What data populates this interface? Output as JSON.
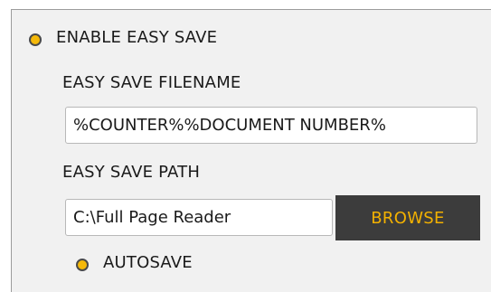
{
  "easy_save": {
    "enable_label": "ENABLE EASY SAVE",
    "enabled": true,
    "filename_label": "EASY SAVE FILENAME",
    "filename_value": "%COUNTER%%DOCUMENT NUMBER%",
    "path_label": "EASY SAVE PATH",
    "path_value": "C:\\Full Page Reader",
    "browse_label": "BROWSE",
    "autosave_label": "AUTOSAVE",
    "autosave_enabled": true
  },
  "colors": {
    "accent": "#f5b90a",
    "button_bg": "#3c3c3c",
    "button_text": "#f3b100",
    "panel_bg": "#f1f1f1"
  }
}
